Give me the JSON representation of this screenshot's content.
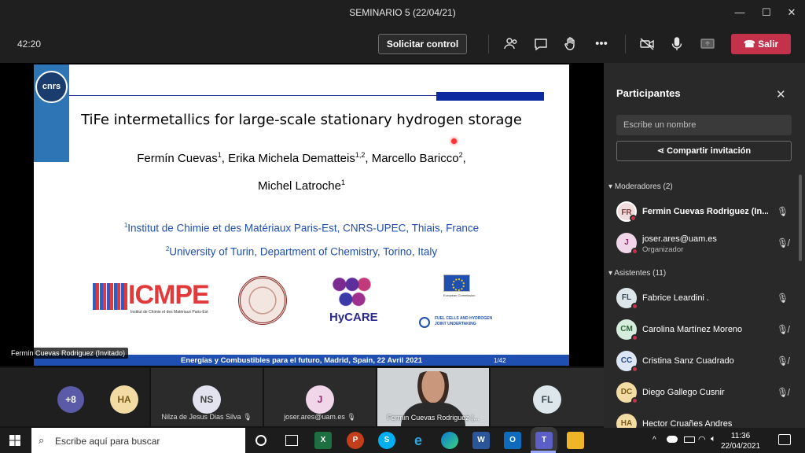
{
  "window": {
    "title": "SEMINARIO 5 (22/04/21)",
    "minimize": "—",
    "maximize": "☐",
    "close": "✕"
  },
  "toolbar": {
    "timer": "42:20",
    "request_control": "Solicitar control",
    "leave": "Salir"
  },
  "slide": {
    "logo": "cnrs",
    "title": "TiFe intermetallics for large-scale stationary hydrogen storage",
    "authors_line1_a": "Fermín Cuevas",
    "authors_line1_a_sup": "1",
    "authors_line1_b": ", Erika Michela Dematteis",
    "authors_line1_b_sup": "1,2",
    "authors_line1_c": ", Marcello Baricco",
    "authors_line1_c_sup": "2",
    "authors_line1_d": ",",
    "authors_line2": "Michel Latroche",
    "authors_line2_sup": "1",
    "affil1_sup": "1",
    "affil1": "Institut de Chimie et des Matériaux Paris-Est, CNRS-UPEC, Thiais, France",
    "affil2_sup": "2",
    "affil2": "University of Turin, Department of Chemistry, Torino, Italy",
    "logo_icmpe": "ICMPE",
    "logo_icmpe_sub": "Institut de Chimie et des Matériaux Paris-Est",
    "logo_hycare": "HyCARE",
    "logo_eu_sub": "European Commission",
    "logo_fch": "FUEL CELLS AND HYDROGEN JOINT UNDERTAKING",
    "footer": "Energías y Combustibles para el futuro, Madrid, Spain, 22 Avril 2021",
    "page": "1/42"
  },
  "presenter_tag": "Fermín Cuevas Rodriguez (Invitado)",
  "tiles": {
    "more": "+8",
    "ha": "HA",
    "ns_initials": "NS",
    "ns_name": "Nilza de Jesus Dias Silva",
    "j_initials": "J",
    "j_name": "joser.ares@uam.es",
    "video_name": "Fermin Cuevas Rodriguez (...",
    "fl": "FL"
  },
  "participants": {
    "title": "Participantes",
    "search_placeholder": "Escribe un nombre",
    "share": "Compartir invitación",
    "moderators_header": "Moderadores (2)",
    "attendees_header": "Asistentes (11)",
    "moderators": [
      {
        "initials": "FR",
        "name": "Fermin Cuevas Rodriguez (In...",
        "sub": ""
      },
      {
        "initials": "J",
        "name": "joser.ares@uam.es",
        "sub": "Organizador"
      }
    ],
    "attendees": [
      {
        "initials": "FL",
        "name": "Fabrice Leardini ."
      },
      {
        "initials": "CM",
        "name": "Carolina Martínez Moreno"
      },
      {
        "initials": "CC",
        "name": "Cristina Sanz Cuadrado"
      },
      {
        "initials": "DC",
        "name": "Diego Gallego Cusnir"
      },
      {
        "initials": "HA",
        "name": "Hector Cruañes Andres"
      }
    ]
  },
  "taskbar": {
    "search_placeholder": "Escribe aquí para buscar",
    "time": "11:36",
    "date": "22/04/2021"
  },
  "colors": {
    "leave": "#c4314b",
    "accent": "#1f4fb0",
    "panel": "#292929"
  }
}
